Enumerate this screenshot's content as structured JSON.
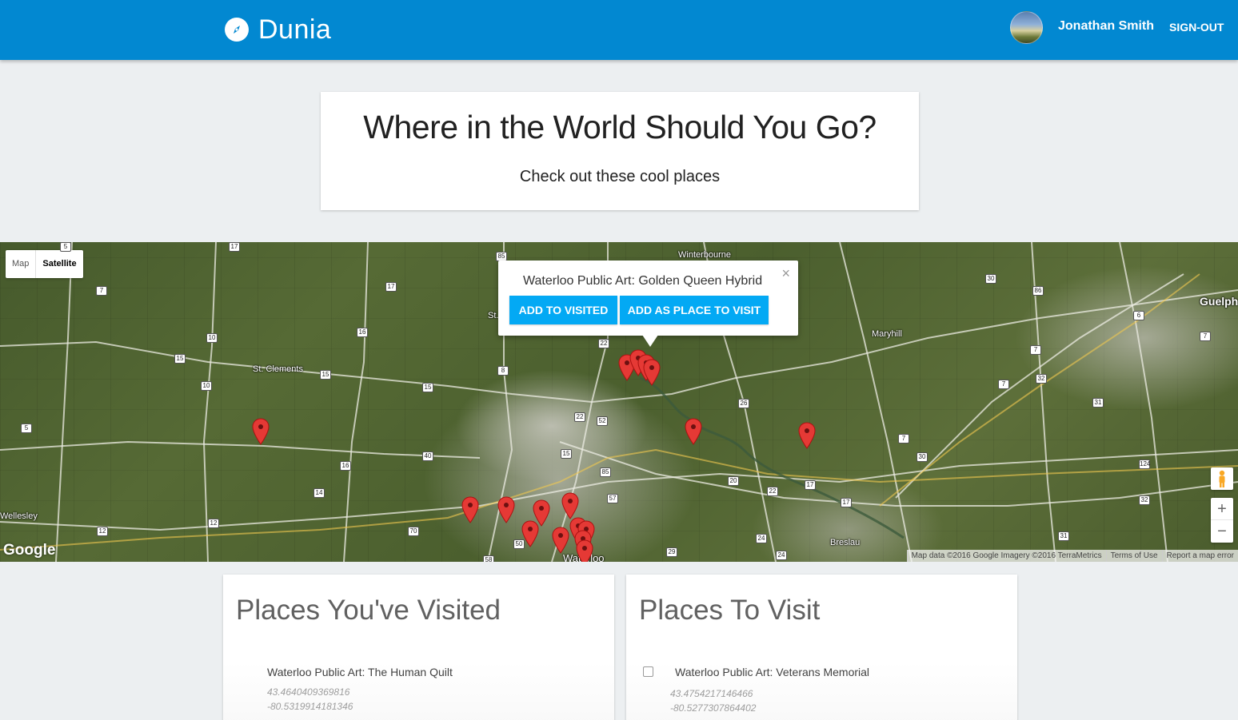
{
  "header": {
    "brand": "Dunia",
    "user_name": "Jonathan Smith",
    "signout_label": "SIGN-OUT",
    "bar_color": "#0288d1",
    "logo_icon": "compass-icon"
  },
  "hero": {
    "title": "Where in the World Should You Go?",
    "subtitle": "Check out these cool places"
  },
  "map": {
    "map_type_options": [
      "Map",
      "Satellite"
    ],
    "selected_map_type": "Satellite",
    "place_labels": [
      "Winterbourne",
      "St. Clements",
      "Maryhill",
      "Guelph",
      "Wellesley",
      "Breslau",
      "Waterloo",
      "St."
    ],
    "road_numbers": [
      "5",
      "17",
      "7",
      "85",
      "17",
      "16",
      "10",
      "15",
      "15",
      "10",
      "15",
      "8",
      "22",
      "5",
      "40",
      "16",
      "14",
      "12",
      "12",
      "70",
      "50",
      "58",
      "22",
      "52",
      "15",
      "85",
      "57",
      "29",
      "26",
      "20",
      "22",
      "17",
      "17",
      "30",
      "86",
      "6",
      "7",
      "7",
      "32",
      "7",
      "7",
      "31",
      "30",
      "124",
      "32",
      "31",
      "24",
      "24"
    ],
    "info_window": {
      "title": "Waterloo Public Art: Golden Queen Hybrid",
      "add_visited_label": "ADD TO VISITED",
      "add_to_visit_label": "ADD AS PLACE TO VISIT",
      "close_label": "×",
      "button_color": "#03a9f4"
    },
    "marker_color": "#e53935",
    "zoom_in_label": "+",
    "zoom_out_label": "−",
    "google_logo": "Google",
    "attribution": [
      "Map data ©2016 Google Imagery ©2016 TerraMetrics",
      "Terms of Use",
      "Report a map error"
    ]
  },
  "visited": {
    "title": "Places You've Visited",
    "items": [
      {
        "name": "Waterloo Public Art: The Human Quilt",
        "lat": "43.4640409369816",
        "lng": "-80.5319914181346"
      }
    ]
  },
  "to_visit": {
    "title": "Places To Visit",
    "items": [
      {
        "name": "Waterloo Public Art: Veterans Memorial",
        "lat": "43.4754217146466",
        "lng": "-80.5277307864402",
        "checked": false
      }
    ]
  }
}
